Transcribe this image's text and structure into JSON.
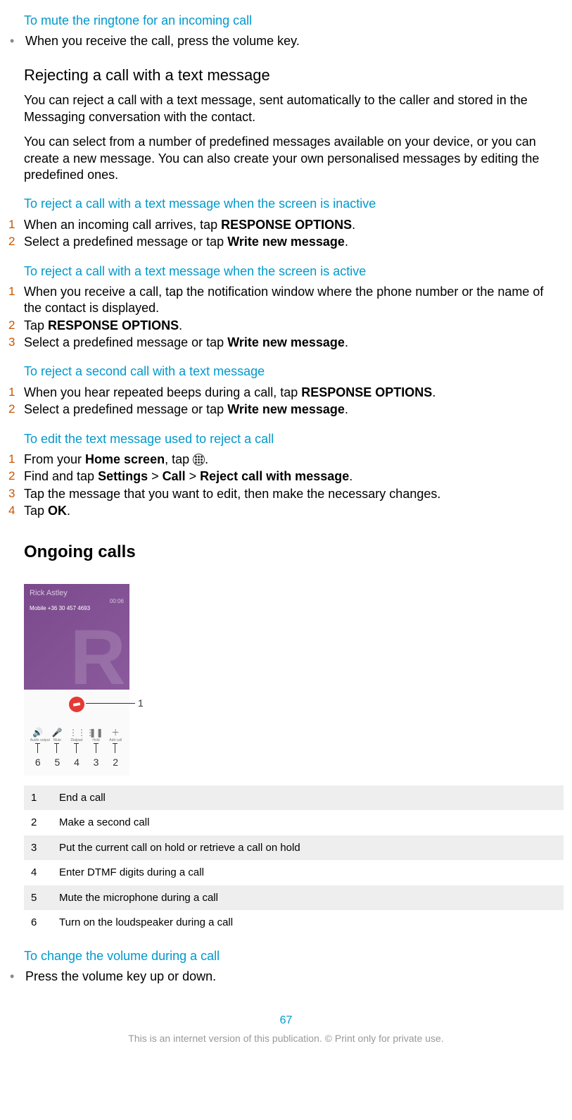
{
  "sec_mute": {
    "title": "To mute the ringtone for an incoming call",
    "bullet": "When you receive the call, press the volume key."
  },
  "sec_reject_heading": "Rejecting a call with a text message",
  "sec_reject_p1": "You can reject a call with a text message, sent automatically to the caller and stored in the Messaging conversation with the contact.",
  "sec_reject_p2": "You can select from a number of predefined messages available on your device, or you can create a new message. You can also create your own personalised messages by editing the predefined ones.",
  "sec_inactive": {
    "title": "To reject a call with a text message when the screen is inactive",
    "steps": {
      "s1a": "When an incoming call arrives, tap ",
      "s1b": "RESPONSE OPTIONS",
      "s1c": ".",
      "s2a": "Select a predefined message or tap ",
      "s2b": "Write new message",
      "s2c": "."
    }
  },
  "sec_active": {
    "title": "To reject a call with a text message when the screen is active",
    "steps": {
      "s1": "When you receive a call, tap the notification window where the phone number or the name of the contact is displayed.",
      "s2a": "Tap ",
      "s2b": "RESPONSE OPTIONS",
      "s2c": ".",
      "s3a": "Select a predefined message or tap ",
      "s3b": "Write new message",
      "s3c": "."
    }
  },
  "sec_second": {
    "title": "To reject a second call with a text message",
    "steps": {
      "s1a": "When you hear repeated beeps during a call, tap ",
      "s1b": "RESPONSE OPTIONS",
      "s1c": ".",
      "s2a": "Select a predefined message or tap ",
      "s2b": "Write new message",
      "s2c": "."
    }
  },
  "sec_edit": {
    "title": "To edit the text message used to reject a call",
    "steps": {
      "s1a": "From your ",
      "s1b": "Home screen",
      "s1c": ", tap ",
      "s1d": ".",
      "s2a": "Find and tap ",
      "s2b": "Settings",
      "s2c": " > ",
      "s2d": "Call",
      "s2e": " > ",
      "s2f": "Reject call with message",
      "s2g": ".",
      "s3": "Tap the message that you want to edit, then make the necessary changes.",
      "s4a": "Tap ",
      "s4b": "OK",
      "s4c": "."
    }
  },
  "ongoing_heading": "Ongoing calls",
  "phone": {
    "name": "Rick Astley",
    "number": "Mobile +36 30 457 4693",
    "time": "00:06",
    "icons": {
      "i1": "Audio output",
      "i2": "Mute",
      "i3": "Dialpad",
      "i4": "Hold",
      "i5": "Add call"
    },
    "callout1": "1",
    "under": {
      "n6": "6",
      "n5": "5",
      "n4": "4",
      "n3": "3",
      "n2": "2"
    }
  },
  "legend": [
    {
      "n": "1",
      "t": "End a call"
    },
    {
      "n": "2",
      "t": "Make a second call"
    },
    {
      "n": "3",
      "t": "Put the current call on hold or retrieve a call on hold"
    },
    {
      "n": "4",
      "t": "Enter DTMF digits during a call"
    },
    {
      "n": "5",
      "t": "Mute the microphone during a call"
    },
    {
      "n": "6",
      "t": "Turn on the loudspeaker during a call"
    }
  ],
  "sec_volume": {
    "title": "To change the volume during a call",
    "bullet": "Press the volume key up or down."
  },
  "page_number": "67",
  "footer": "This is an internet version of this publication. © Print only for private use."
}
